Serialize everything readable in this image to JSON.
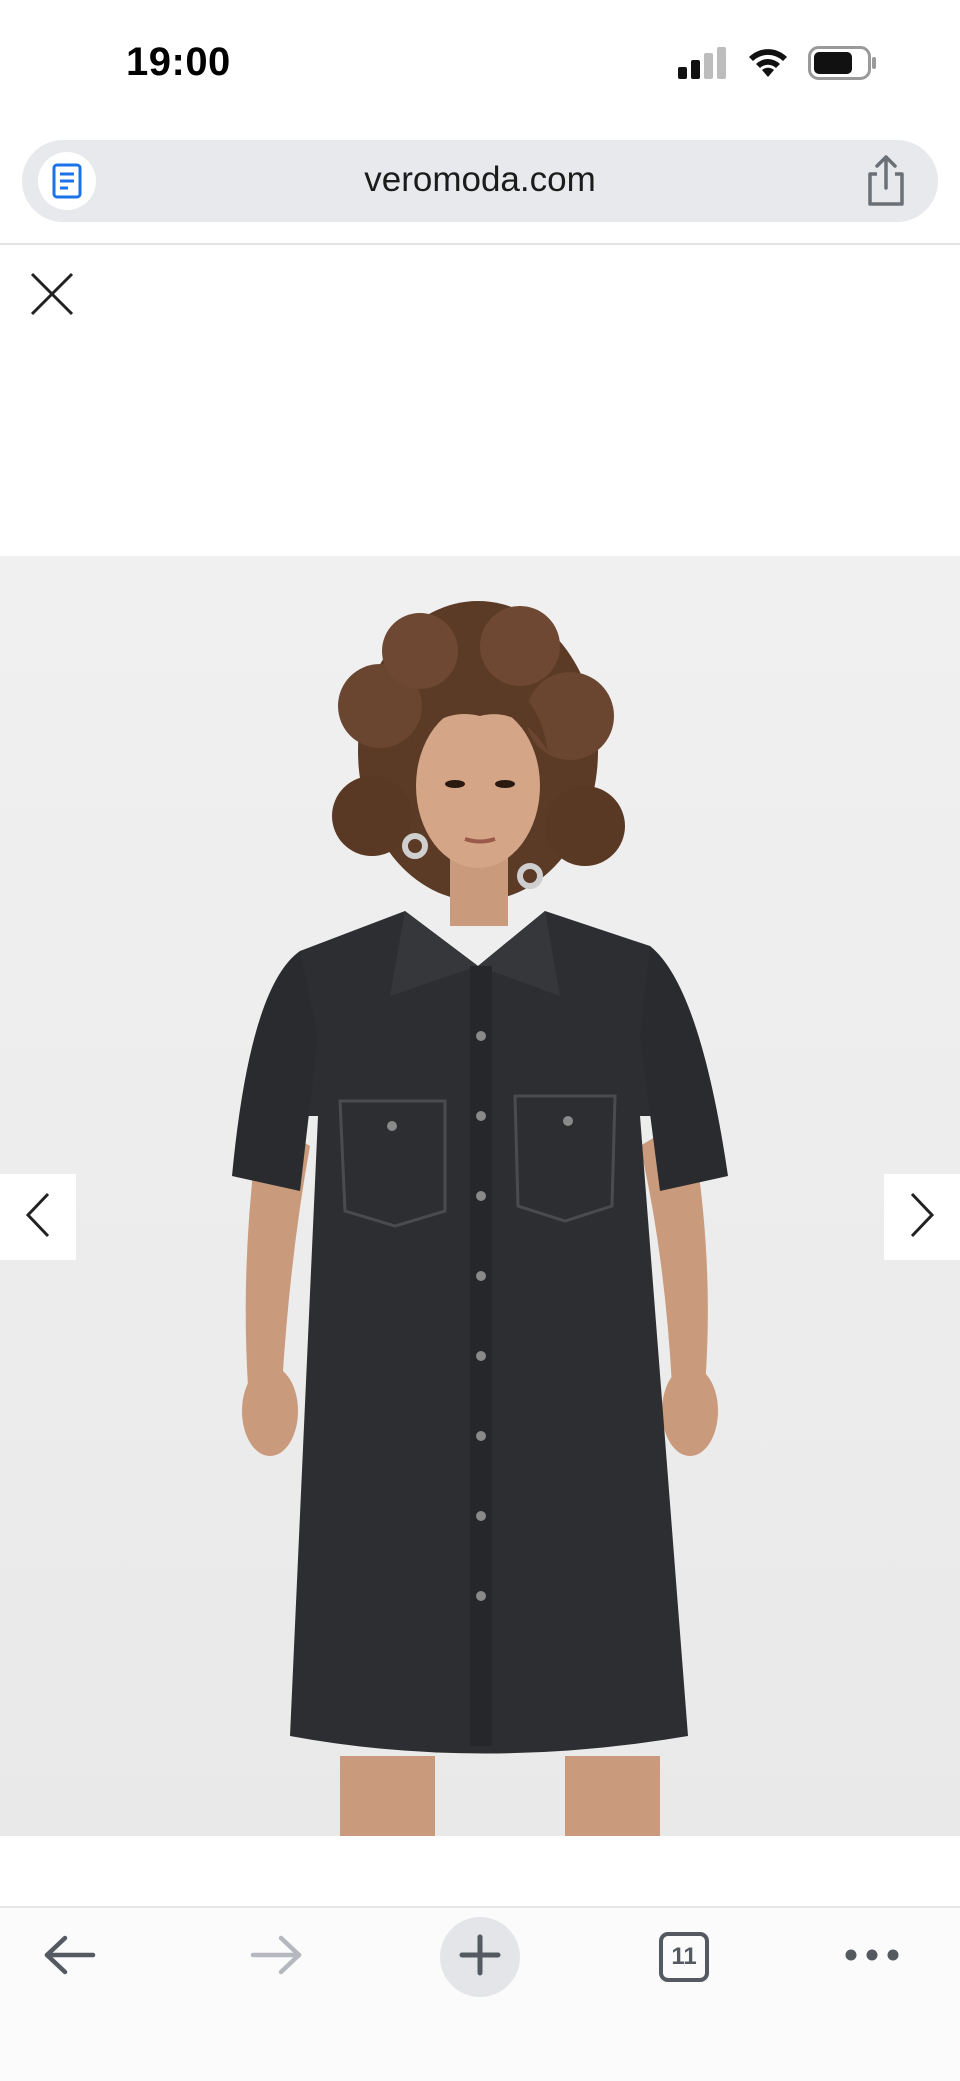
{
  "status_bar": {
    "time": "19:00",
    "icons": [
      "signal-icon",
      "wifi-icon",
      "battery-icon"
    ]
  },
  "browser": {
    "url": "veromoda.com",
    "icons": [
      "reader-icon",
      "share-icon"
    ]
  },
  "overlay": {
    "close_icon": "close-icon"
  },
  "gallery": {
    "image_subject": "product-photo",
    "prev_icon": "chevron-left-icon",
    "next_icon": "chevron-right-icon"
  },
  "toolbar": {
    "tabs_count": "11",
    "icons": [
      "arrow-left-icon",
      "arrow-right-icon",
      "plus-icon",
      "tabs-icon",
      "more-icon"
    ]
  },
  "colors": {
    "accent": "#1a73e8",
    "toolbar_icon": "#555a62",
    "disabled_icon": "#b5b8be",
    "garment": "#2d2e31"
  }
}
